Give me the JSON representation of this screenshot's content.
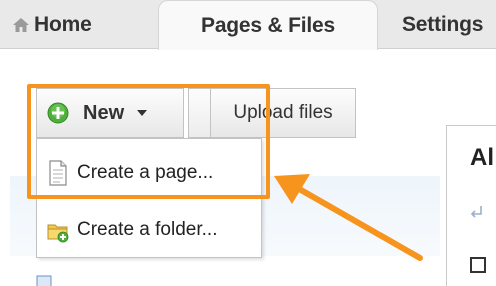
{
  "tabs": {
    "home": "Home",
    "pages_files": "Pages & Files",
    "settings": "Settings"
  },
  "toolbar": {
    "new_label": "New",
    "upload_label": "Upload files"
  },
  "new_menu": {
    "create_page": "Create a page...",
    "create_folder": "Create a folder..."
  },
  "content": {
    "title_fragment": "Al"
  },
  "colors": {
    "highlight": "#f7941d",
    "new_icon": "#4fae3c",
    "tab_bar": "#e9e9e9"
  },
  "icons": {
    "home": "home-icon",
    "new": "plus-circle-icon",
    "caret": "caret-down-icon",
    "page": "page-icon",
    "folder": "new-folder-icon",
    "return": "return-arrow-icon"
  }
}
